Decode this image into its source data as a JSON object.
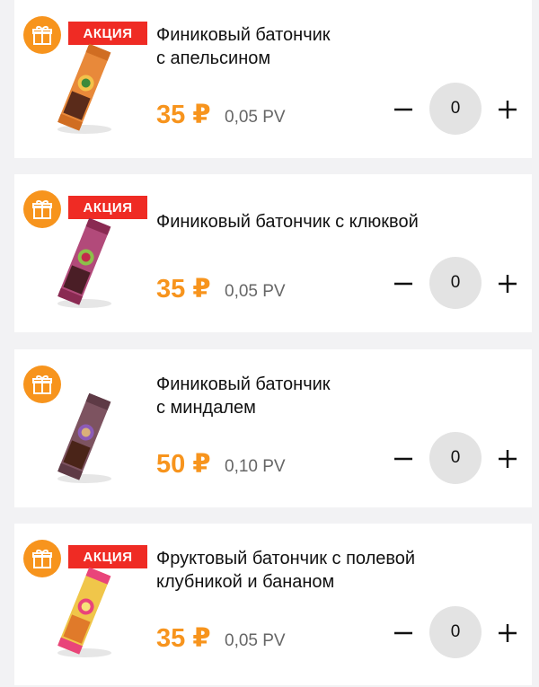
{
  "products": [
    {
      "title": "Финиковый батончик\nс апельсином",
      "price": "35 ₽",
      "pv": "0,05 PV",
      "quantity": "0",
      "promo_label": "АКЦИЯ",
      "wrapper_color": "#e8893a",
      "accent_color": "#f3c24a"
    },
    {
      "title": "Финиковый батончик с клюквой",
      "price": "35 ₽",
      "pv": "0,05 PV",
      "quantity": "0",
      "promo_label": "АКЦИЯ",
      "wrapper_color": "#b24a7a",
      "accent_color": "#8a2a52"
    },
    {
      "title": "Финиковый батончик\nс миндалем",
      "price": "50 ₽",
      "pv": "0,10 PV",
      "quantity": "0",
      "promo_label": "",
      "wrapper_color": "#7d5360",
      "accent_color": "#8c5bb8"
    },
    {
      "title": "Фруктовый батончик с полевой\nклубникой и бананом",
      "price": "35 ₽",
      "pv": "0,05 PV",
      "quantity": "0",
      "promo_label": "АКЦИЯ",
      "wrapper_color": "#f0c64a",
      "accent_color": "#e9447a"
    }
  ],
  "icons": {
    "gift": "gift-icon",
    "minus": "minus-icon",
    "plus": "plus-icon"
  },
  "colors": {
    "brand_orange": "#f7941d",
    "promo_red": "#ef2b24",
    "background": "#f2f2f4",
    "qty_circle": "#e3e3e3"
  }
}
